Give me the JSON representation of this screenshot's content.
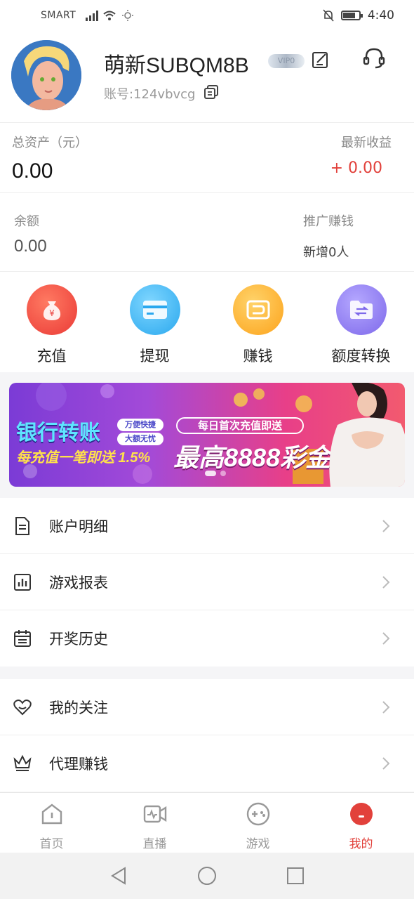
{
  "status_bar": {
    "carrier": "SMART",
    "time": "4:40",
    "icons": [
      "signal-icon",
      "wifi-icon",
      "brightness-icon",
      "silent-icon",
      "battery-icon"
    ]
  },
  "profile": {
    "username": "萌新SUBQM8B",
    "vip_badge": "VIP0",
    "account_label": "账号:124vbvcg"
  },
  "assets": {
    "total_label": "总资产（元）",
    "total_value": "0.00",
    "latest_label": "最新收益",
    "latest_value": "+  0.00",
    "balance_label": "余额",
    "balance_value": "0.00",
    "promo_label": "推广赚钱",
    "promo_value": "新增0人"
  },
  "actions": [
    {
      "label": "充值",
      "icon": "money-bag-icon",
      "color": "#ef4d42"
    },
    {
      "label": "提现",
      "icon": "card-icon",
      "color": "#3cb7f2"
    },
    {
      "label": "赚钱",
      "icon": "wallet-icon",
      "color": "#fdb42b"
    },
    {
      "label": "额度转换",
      "icon": "transfer-folder-icon",
      "color": "#8f7df0"
    }
  ],
  "banner": {
    "title": "银行转账",
    "tag1": "万便快捷",
    "tag2": "大额无忧",
    "subtitle": "每充值一笔即送 1.5%",
    "pill": "每日首次充值即送",
    "big": "最高8888彩金"
  },
  "menu_group_1": [
    {
      "label": "账户明细",
      "icon": "document-icon"
    },
    {
      "label": "游戏报表",
      "icon": "bar-chart-icon"
    },
    {
      "label": "开奖历史",
      "icon": "calendar-icon"
    }
  ],
  "menu_group_2": [
    {
      "label": "我的关注",
      "icon": "heart-icon"
    },
    {
      "label": "代理赚钱",
      "icon": "crown-icon"
    }
  ],
  "tabs": [
    {
      "label": "首页",
      "icon": "home-icon"
    },
    {
      "label": "直播",
      "icon": "live-video-icon"
    },
    {
      "label": "游戏",
      "icon": "gamepad-icon"
    },
    {
      "label": "我的",
      "icon": "profile-icon",
      "active": true
    }
  ],
  "colors": {
    "accent": "#e2413b"
  }
}
